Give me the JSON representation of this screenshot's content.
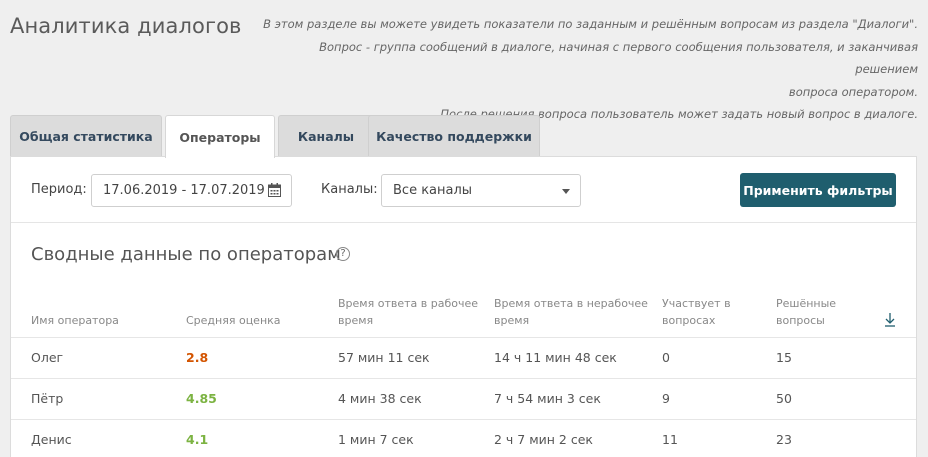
{
  "header": {
    "title": "Аналитика диалогов",
    "description": [
      "В этом разделе вы можете увидеть показатели по заданным и решённым вопросам из раздела \"Диалоги\".",
      "Вопрос - группа сообщений в диалоге, начиная с первого сообщения пользователя, и заканчивая решением",
      "вопроса оператором.",
      "После решения вопроса пользователь может задать новый вопрос в диалоге."
    ]
  },
  "tabs": [
    {
      "label": "Общая статистика",
      "active": false
    },
    {
      "label": "Операторы",
      "active": true
    },
    {
      "label": "Каналы",
      "active": false
    },
    {
      "label": "Качество поддержки",
      "active": false
    }
  ],
  "filters": {
    "period_label": "Период:",
    "period_value": "17.06.2019 - 17.07.2019",
    "channels_label": "Каналы:",
    "channels_value": "Все каналы",
    "apply_label": "Применить фильтры"
  },
  "summary": {
    "title": "Сводные данные по операторам",
    "help_glyph": "?",
    "columns": [
      [
        "Имя оператора"
      ],
      [
        "Средняя оценка"
      ],
      [
        "Время ответа в рабочее",
        "время"
      ],
      [
        "Время ответа в нерабочее",
        "время"
      ],
      [
        "Участвует в",
        "вопросах"
      ],
      [
        "Решённые",
        "вопросы"
      ]
    ],
    "rows": [
      {
        "name": "Олег",
        "score": "2.8",
        "score_level": "low",
        "work_time": "57 мин 11 сек",
        "offwork_time": "14 ч 11 мин 48 сек",
        "participates": "0",
        "resolved": "15"
      },
      {
        "name": "Пётр",
        "score": "4.85",
        "score_level": "high",
        "work_time": "4 мин 38 сек",
        "offwork_time": "7 ч 54 мин 3 сек",
        "participates": "9",
        "resolved": "50"
      },
      {
        "name": "Денис",
        "score": "4.1",
        "score_level": "high",
        "work_time": "1 мин 7 сек",
        "offwork_time": "2 ч 7 мин 2 сек",
        "participates": "11",
        "resolved": "23"
      }
    ]
  },
  "icons": {
    "calendar": "calendar-icon",
    "dropdown": "chevron-down-icon",
    "help": "help-circle-icon",
    "download": "download-icon"
  },
  "colors": {
    "accent": "#1f5e6e",
    "score_low": "#d35400",
    "score_high": "#7cb342"
  }
}
